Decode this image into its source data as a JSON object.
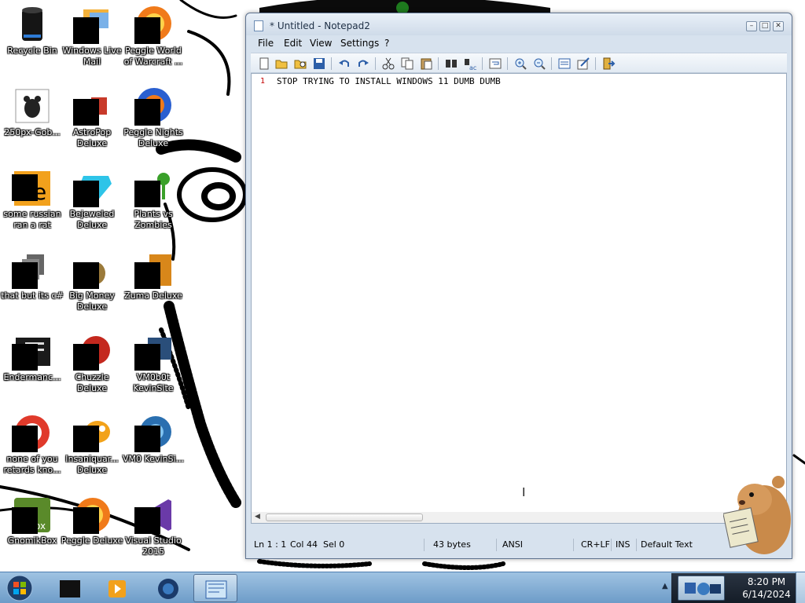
{
  "desktop": {
    "icons": [
      {
        "label": "Recycle Bin"
      },
      {
        "label": "Windows Live Mail"
      },
      {
        "label": "Peggle World of Warcraft ..."
      },
      {
        "label": "250px-Gob..."
      },
      {
        "label": "AstroPop Deluxe"
      },
      {
        "label": "Peggle Nights Deluxe"
      },
      {
        "label": "some russian ran a rat"
      },
      {
        "label": "Bejeweled Deluxe"
      },
      {
        "label": "Plants vs Zombies"
      },
      {
        "label": "that but its c#"
      },
      {
        "label": "Big Money Deluxe"
      },
      {
        "label": "Zuma Deluxe"
      },
      {
        "label": "Endermanc..."
      },
      {
        "label": "Chuzzle Deluxe"
      },
      {
        "label": "VM0b0t KevinSite"
      },
      {
        "label": "none of you retards kno..."
      },
      {
        "label": "Insaniquar... Deluxe"
      },
      {
        "label": "VM0 KevinSi..."
      },
      {
        "label": "GnomikBox"
      },
      {
        "label": "Peggle Deluxe"
      },
      {
        "label": "Visual Studio 2015"
      }
    ]
  },
  "notepad": {
    "title": "* Untitled - Notepad2",
    "menu": [
      "File",
      "Edit",
      "View",
      "Settings",
      "?"
    ],
    "toolbar": [
      "new-icon",
      "open-icon",
      "browse-icon",
      "save-icon",
      "undo-icon",
      "redo-icon",
      "cut-icon",
      "copy-icon",
      "paste-icon",
      "find-icon",
      "replace-icon",
      "word-wrap-icon",
      "zoom-in-icon",
      "zoom-out-icon",
      "select-scheme-icon",
      "customize-scheme-icon",
      "exit-icon"
    ],
    "line_number": "1",
    "content": "STOP TRYING TO INSTALL WINDOWS 11 DUMB DUMB",
    "status": {
      "position": "Ln 1 : 1",
      "column": "Col 44",
      "selection": "Sel 0",
      "size": "43 bytes",
      "encoding": "ANSI",
      "line_endings": "CR+LF",
      "mode": "INS",
      "scheme": "Default Text"
    }
  },
  "taskbar": {
    "apps": [
      "black-box-app-icon",
      "media-player-icon",
      "orb-app-icon",
      "notepad-app-icon"
    ],
    "clock": {
      "time": "8:20 PM",
      "date": "6/14/2024"
    }
  },
  "colors": {
    "title_text": "#1e2f45",
    "line_number": "#c40000",
    "taskbar": "#7aa6cf"
  }
}
